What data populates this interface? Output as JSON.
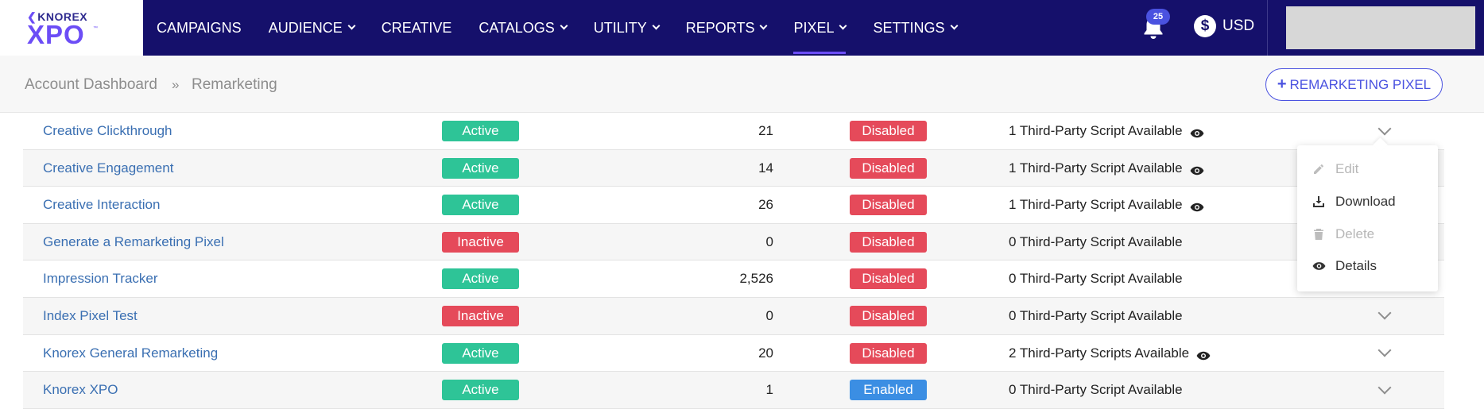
{
  "brand": {
    "top": "KNOREX",
    "main": "XPO",
    "tm": "™"
  },
  "nav": [
    {
      "label": "CAMPAIGNS",
      "dropdown": false,
      "active": false
    },
    {
      "label": "AUDIENCE",
      "dropdown": true,
      "active": false
    },
    {
      "label": "CREATIVE",
      "dropdown": false,
      "active": false
    },
    {
      "label": "CATALOGS",
      "dropdown": true,
      "active": false
    },
    {
      "label": "UTILITY",
      "dropdown": true,
      "active": false
    },
    {
      "label": "REPORTS",
      "dropdown": true,
      "active": false
    },
    {
      "label": "PIXEL",
      "dropdown": true,
      "active": true
    },
    {
      "label": "SETTINGS",
      "dropdown": true,
      "active": false
    }
  ],
  "notifications": {
    "count": "25"
  },
  "currency": {
    "symbol": "$",
    "label": "USD"
  },
  "breadcrumb": {
    "parent": "Account Dashboard",
    "separator": "»",
    "current": "Remarketing"
  },
  "actions": {
    "add_plus": "+",
    "add_label": "REMARKETING PIXEL"
  },
  "rows": [
    {
      "name": "Creative Clickthrough",
      "status": "Active",
      "count": "21",
      "third_party": "Disabled",
      "scripts": "1 Third-Party Script Available",
      "eye": true,
      "chevron": true
    },
    {
      "name": "Creative Engagement",
      "status": "Active",
      "count": "14",
      "third_party": "Disabled",
      "scripts": "1 Third-Party Script Available",
      "eye": true,
      "chevron": false
    },
    {
      "name": "Creative Interaction",
      "status": "Active",
      "count": "26",
      "third_party": "Disabled",
      "scripts": "1 Third-Party Script Available",
      "eye": true,
      "chevron": false
    },
    {
      "name": "Generate a Remarketing Pixel",
      "status": "Inactive",
      "count": "0",
      "third_party": "Disabled",
      "scripts": "0 Third-Party Script Available",
      "eye": false,
      "chevron": false
    },
    {
      "name": "Impression Tracker",
      "status": "Active",
      "count": "2,526",
      "third_party": "Disabled",
      "scripts": "0 Third-Party Script Available",
      "eye": false,
      "chevron": false
    },
    {
      "name": "Index Pixel Test",
      "status": "Inactive",
      "count": "0",
      "third_party": "Disabled",
      "scripts": "0 Third-Party Script Available",
      "eye": false,
      "chevron": true
    },
    {
      "name": "Knorex General Remarketing",
      "status": "Active",
      "count": "20",
      "third_party": "Disabled",
      "scripts": "2 Third-Party Scripts Available",
      "eye": true,
      "chevron": true
    },
    {
      "name": "Knorex XPO",
      "status": "Active",
      "count": "1",
      "third_party": "Enabled",
      "scripts": "0 Third-Party Script Available",
      "eye": false,
      "chevron": true
    }
  ],
  "row_menu": {
    "items": [
      {
        "label": "Edit",
        "icon": "pencil-icon",
        "enabled": false
      },
      {
        "label": "Download",
        "icon": "download-icon",
        "enabled": true
      },
      {
        "label": "Delete",
        "icon": "trash-icon",
        "enabled": false
      },
      {
        "label": "Details",
        "icon": "eye-icon",
        "enabled": true
      }
    ]
  },
  "colors": {
    "nav_bg": "#15106b",
    "accent": "#6c4df6",
    "link": "#3a6fb2",
    "active_green": "#2ec497",
    "disabled_red": "#e54a5a",
    "enabled_blue": "#3b8ee3"
  }
}
